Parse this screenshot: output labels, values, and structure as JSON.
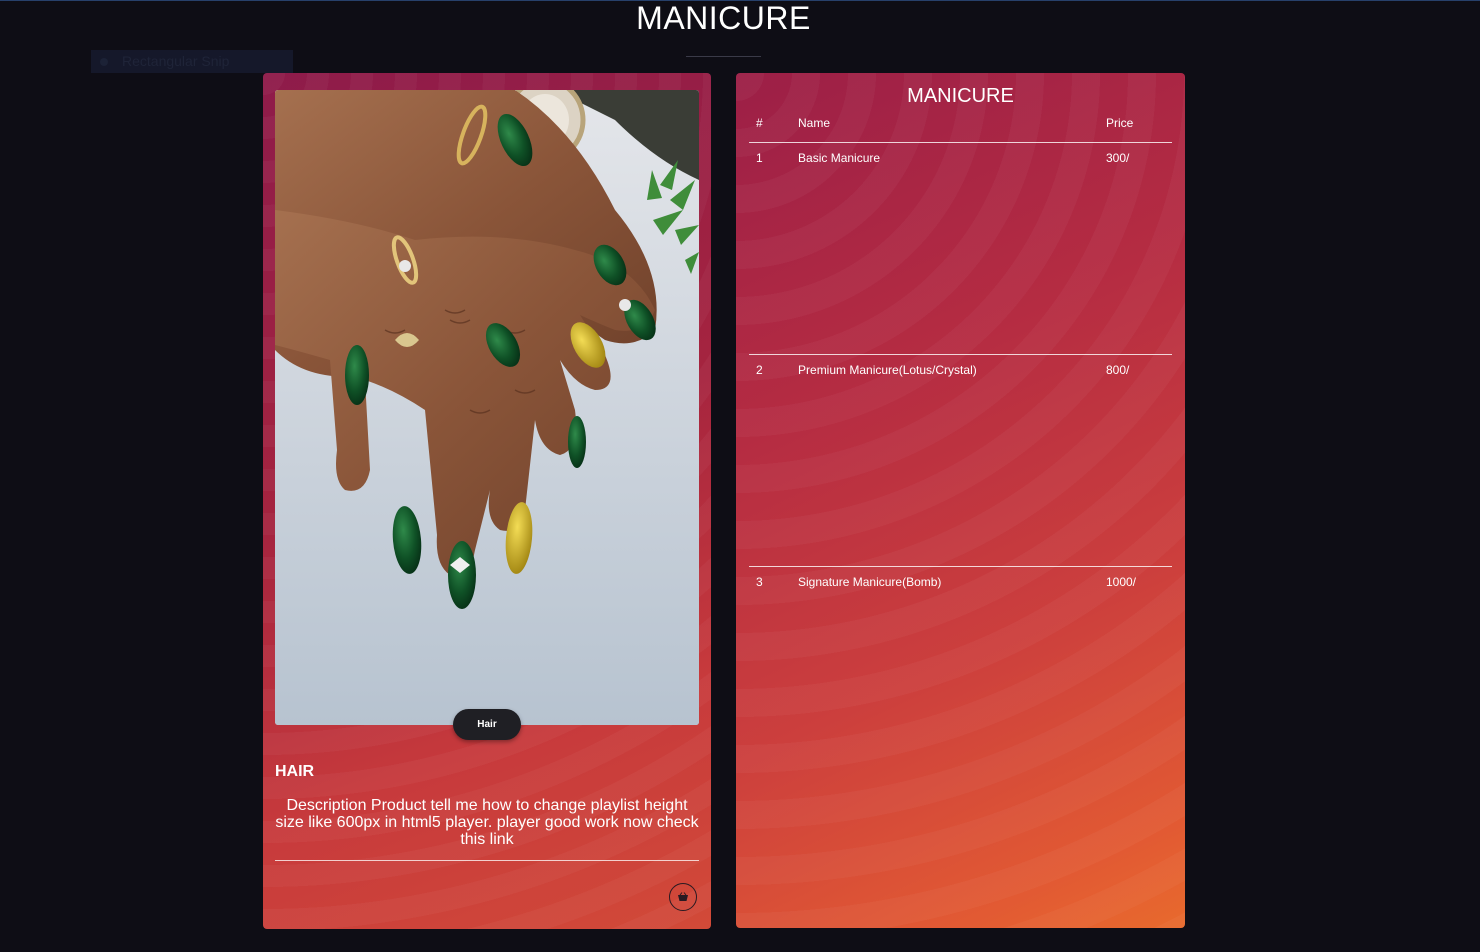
{
  "page": {
    "title": "MANICURE"
  },
  "snip_overlay": {
    "label": "Rectangular Snip"
  },
  "product_card": {
    "image_alt": "Hands with green and gold glitter nail art",
    "tag_button_label": "Hair",
    "heading": "HAIR",
    "description": "Description Product tell me how to change playlist height size like 600px in html5 player. player good work now check this link",
    "basket_icon": "basket-icon"
  },
  "menu": {
    "title": "MANICURE",
    "columns": [
      "#",
      "Name",
      "Price"
    ],
    "rows": [
      {
        "num": "1",
        "name": "Basic Manicure",
        "price": "300/"
      },
      {
        "num": "2",
        "name": "Premium Manicure(Lotus/Crystal)",
        "price": "800/"
      },
      {
        "num": "3",
        "name": "Signature Manicure(Bomb)",
        "price": "1000/"
      }
    ]
  },
  "colors": {
    "background": "#0e0d15",
    "card_gradient_start": "#8e1b4a",
    "card_gradient_end": "#e86a2d",
    "pill_button": "#1f1f24"
  }
}
